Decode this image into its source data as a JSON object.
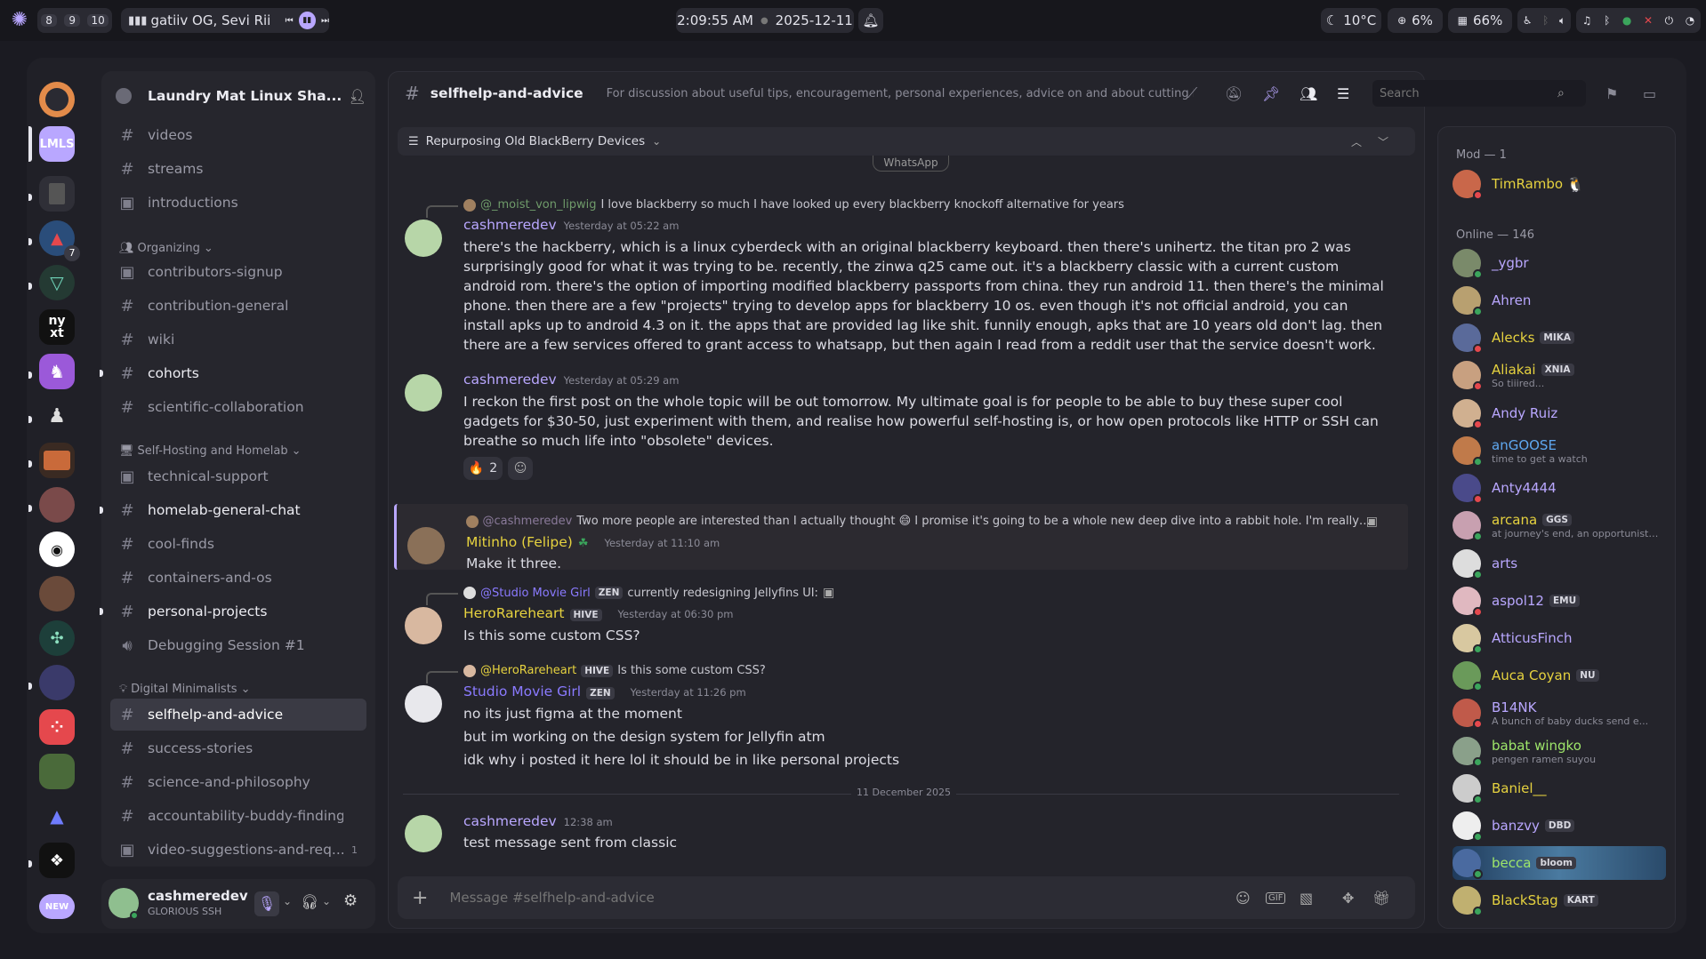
{
  "system_bar": {
    "workspaces": [
      "8",
      "9",
      "10"
    ],
    "media": "gatiiv OG, Sevi Rii",
    "time": "2:09:55 AM",
    "date": "2025-12-11",
    "weather": "10°C",
    "cpu": "6%",
    "memory": "66%"
  },
  "server": {
    "name": "Laundry Mat Linux Sha...",
    "rail_labels": {
      "lmls": "LMLS",
      "nyxt": "ny\nxt",
      "new": "NEW",
      "badge": "7"
    }
  },
  "channels": [
    {
      "name": "videos",
      "type": "text"
    },
    {
      "name": "streams",
      "type": "text"
    },
    {
      "name": "introductions",
      "type": "forum"
    },
    {
      "category": "Organizing"
    },
    {
      "name": "contributors-signup",
      "type": "forum"
    },
    {
      "name": "contribution-general",
      "type": "text"
    },
    {
      "name": "wiki",
      "type": "text"
    },
    {
      "name": "cohorts",
      "type": "text",
      "unread": true
    },
    {
      "name": "scientific-collaboration",
      "type": "text"
    },
    {
      "category": "Self-Hosting and Homelab"
    },
    {
      "name": "technical-support",
      "type": "forum"
    },
    {
      "name": "homelab-general-chat",
      "type": "text",
      "unread": true
    },
    {
      "name": "cool-finds",
      "type": "text"
    },
    {
      "name": "containers-and-os",
      "type": "text"
    },
    {
      "name": "personal-projects",
      "type": "text",
      "unread": true
    },
    {
      "name": "Debugging Session #1",
      "type": "voice"
    },
    {
      "category": "Digital Minimalists"
    },
    {
      "name": "selfhelp-and-advice",
      "type": "text",
      "active": true
    },
    {
      "name": "success-stories",
      "type": "text"
    },
    {
      "name": "science-and-philosophy",
      "type": "text"
    },
    {
      "name": "accountability-buddy-finding",
      "type": "text"
    },
    {
      "name": "video-suggestions-and-req...",
      "type": "forum",
      "badge": "1"
    }
  ],
  "user": {
    "name": "cashmeredev",
    "status": "GLORIOUS SSH"
  },
  "chat": {
    "channel": "selfhelp-and-advice",
    "topic": "For discussion about useful tips, encouragement, personal experiences, advice on and about cutting ba...",
    "search_placeholder": "Search",
    "thread": "Repurposing Old BlackBerry Devices",
    "cut_image_text": "WhatsApp",
    "date_divider": "11 December 2025",
    "composer_placeholder": "Message #selfhelp-and-advice",
    "messages": [
      {
        "reply_to": "@_moist_von_lipwig",
        "reply_text": "I love blackberry so much I have looked up every blackberry knockoff alternative for years",
        "author": "cashmeredev",
        "time": "Yesterday at 05:22 am",
        "lines": [
          "there's the hackberry, which is a linux cyberdeck with an original blackberry keyboard. then there's unihertz. the titan pro 2 was surprisingly good for what it was trying to be. recently, the zinwa q25 came out. it's a blackberry classic with a current custom android rom. there's the option of importing modified blackberry passports from china. they run android 11. then there's the minimal phone. then there are a few \"projects\" trying to develop apps for blackberry 10 os. even though it's not official android, you can install apks up to android 4.3 on it. the apps that are provided lag like shit. funnily enough, apks that are 10 years old don't lag. then there are a few services offered to grant access to whatsapp, but then again I read from a reddit user that the service doesn't work."
        ]
      },
      {
        "author": "cashmeredev",
        "time": "Yesterday at 05:29 am",
        "lines": [
          "I reckon the first post on the whole topic will be out tomorrow. My ultimate goal is for people to be able to buy these super cool gadgets for $30-50, just experiment with them, and realise how powerful self-hosting is, or how open protocols like HTTP or SSH can breathe so much life into \"obsolete\" devices."
        ],
        "reaction": {
          "emoji": "🔥",
          "count": "2"
        }
      },
      {
        "reply_to": "@cashmeredev",
        "reply_text": "Two more people are interested than I actually thought 😄 I promise it's going to be a whole new deep dive into a rabbit hole. I'm really excit...",
        "author": "Mitinho (Felipe)",
        "time": "Yesterday at 11:10 am",
        "lines": [
          "Make it three."
        ]
      },
      {
        "reply_to": "@Studio Movie Girl",
        "reply_tag": "ZEN",
        "reply_text": "currently redesigning Jellyfins UI:",
        "author": "HeroRareheart",
        "tag": "HIVE",
        "time": "Yesterday at 06:30 pm",
        "lines": [
          "Is this some custom CSS?"
        ]
      },
      {
        "reply_to": "@HeroRareheart",
        "reply_tag": "HIVE",
        "reply_text": "Is this some custom CSS?",
        "author": "Studio Movie Girl",
        "tag": "ZEN",
        "time": "Yesterday at 11:26 pm",
        "lines": [
          "no its just figma at the moment",
          "but im working on the design system for Jellyfin atm",
          "idk why i posted it here lol it should be in like personal projects"
        ]
      },
      {
        "author": "cashmeredev",
        "time": "12:38 am",
        "lines": [
          "test message sent from classic"
        ]
      }
    ]
  },
  "members": {
    "groups": [
      {
        "title": "Mod — 1"
      },
      {
        "title": "Online — 146"
      }
    ],
    "list": [
      {
        "name": "TimRambo",
        "color": "#e6d23f",
        "status": "#e5484d",
        "extra": "🐧"
      },
      {
        "name": "_ygbr",
        "color": "#b9a7ff",
        "status": "#3ba55c"
      },
      {
        "name": "Ahren",
        "color": "#b9a7ff",
        "status": "#3ba55c"
      },
      {
        "name": "Alecks",
        "color": "#e6d23f",
        "status": "#e5484d",
        "tag": "MIKA"
      },
      {
        "name": "Aliakai",
        "color": "#e6d23f",
        "status": "#e5484d",
        "tag": "XNIA",
        "sub": "So tiiired..."
      },
      {
        "name": "Andy Ruiz",
        "color": "#b9a7ff",
        "status": "#e5484d"
      },
      {
        "name": "anGOOSE",
        "color": "#5fa8f0",
        "status": "#3ba55c",
        "sub": "time to get a watch"
      },
      {
        "name": "Anty4444",
        "color": "#b9a7ff",
        "status": "#e5484d"
      },
      {
        "name": "arcana",
        "color": "#e6d23f",
        "status": "#3ba55c",
        "tag": "GGS",
        "sub": "at journey's end, an opportunistic..."
      },
      {
        "name": "arts",
        "color": "#b9a7ff",
        "status": "#3ba55c"
      },
      {
        "name": "aspol12",
        "color": "#b9a7ff",
        "status": "#e5484d",
        "tag": "EMU"
      },
      {
        "name": "AtticusFinch",
        "color": "#b9a7ff",
        "status": "#3ba55c"
      },
      {
        "name": "Auca Coyan",
        "color": "#e6d23f",
        "status": "#3ba55c",
        "tag": "NU"
      },
      {
        "name": "B14NK",
        "color": "#b9a7ff",
        "status": "#e5484d",
        "sub": "A bunch of baby ducks send e..."
      },
      {
        "name": "babat wingko",
        "color": "#9ee66a",
        "status": "#3ba55c",
        "sub": "pengen ramen suyou"
      },
      {
        "name": "Baniel__",
        "color": "#e6d23f",
        "status": "#3ba55c"
      },
      {
        "name": "banzvy",
        "color": "#b9a7ff",
        "status": "#3ba55c",
        "tag": "DBD"
      },
      {
        "name": "becca",
        "color": "#9ee66a",
        "status": "#3ba55c",
        "tag": "bloom"
      },
      {
        "name": "BlackStag",
        "color": "#e6d23f",
        "status": "#3ba55c",
        "tag": "KART"
      }
    ]
  }
}
